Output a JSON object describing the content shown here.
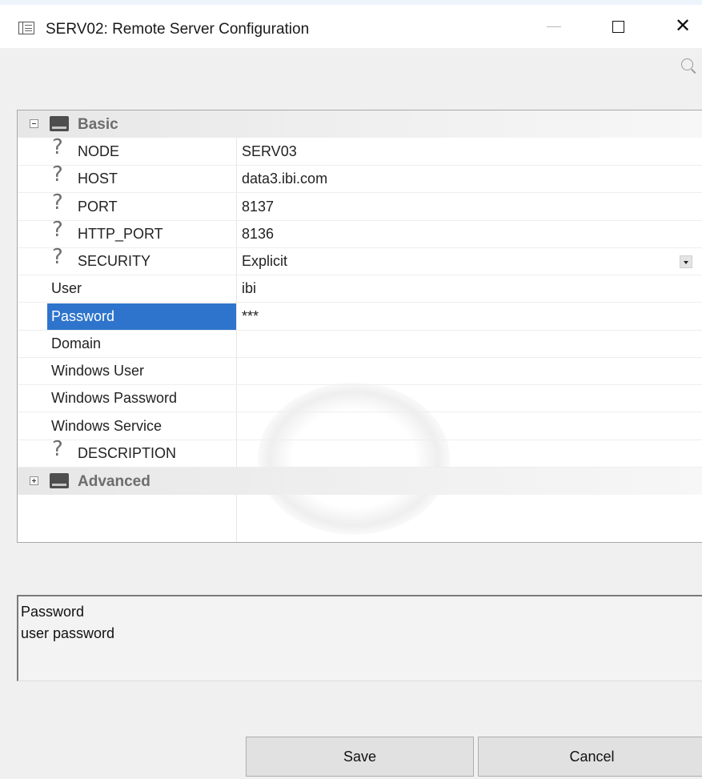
{
  "window": {
    "title": "SERV02: Remote Server Configuration"
  },
  "property_grid": {
    "categories": [
      {
        "label": "Basic",
        "expanded": true
      },
      {
        "label": "Advanced",
        "expanded": false
      }
    ],
    "properties": [
      {
        "name": "NODE",
        "value": "SERV03",
        "has_help": true
      },
      {
        "name": "HOST",
        "value": "data3.ibi.com",
        "has_help": true
      },
      {
        "name": "PORT",
        "value": "8137",
        "has_help": true
      },
      {
        "name": "HTTP_PORT",
        "value": "8136",
        "has_help": true
      },
      {
        "name": "SECURITY",
        "value": "Explicit",
        "has_help": true,
        "dropdown": true
      },
      {
        "name": "User",
        "value": "ibi",
        "has_help": false
      },
      {
        "name": "Password",
        "value": "***",
        "has_help": false,
        "selected": true
      },
      {
        "name": "Domain",
        "value": "",
        "has_help": false
      },
      {
        "name": "Windows User",
        "value": "",
        "has_help": false
      },
      {
        "name": "Windows Password",
        "value": "",
        "has_help": false
      },
      {
        "name": "Windows Service",
        "value": "",
        "has_help": false
      },
      {
        "name": "DESCRIPTION",
        "value": "",
        "has_help": true
      }
    ],
    "help_glyph": "?"
  },
  "description_panel": {
    "title": "Password",
    "text": "user password"
  },
  "buttons": {
    "save": "Save",
    "cancel": "Cancel"
  },
  "colors": {
    "selection": "#2e74cc",
    "category_text": "#6d6d6d"
  },
  "icons": [
    "app-window-icon",
    "minimize-icon",
    "maximize-icon",
    "close-icon",
    "search-icon",
    "collapse-icon",
    "expand-icon",
    "category-icon",
    "help-icon",
    "dropdown-arrow-icon"
  ]
}
